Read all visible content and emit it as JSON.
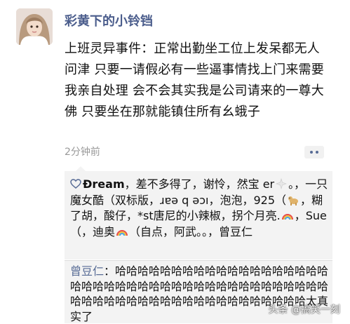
{
  "post": {
    "username": "彩黄下的小铃铛",
    "text": "上班灵异事件：正常出勤坐工位上发呆都无人问津 只要一请假必有一些逼事情找上门来需要我亲自处理 会不会其实我是公司请来的一尊大佛 只要坐在那就能镇住所有幺蛾子",
    "time": "2分钟前"
  },
  "likes": {
    "segments": [
      "Ðream",
      "，差不多得了，谢怜，然宝 er",
      "。，一只魔女酷（双标版，ɹɐǝ q ǝɔı，泡泡，925（",
      "，糊了胡，酸仔，*st唐尼的小辣椒，拐个月亮.",
      "，Sue（，迪奥",
      "（自点，阿武。。，曾豆仁"
    ]
  },
  "comment": {
    "author": "曾豆仁",
    "separator": "：",
    "text": "哈哈哈哈哈哈哈哈哈哈哈哈哈哈哈哈哈哈哈哈哈哈哈哈哈哈哈哈哈哈哈哈哈哈哈哈哈哈哈哈哈哈哈哈哈哈哈哈哈哈哈哈哈哈哈哈哈哈哈哈哈哈哈太真实了"
  },
  "watermark": "头条 @搞笑一刻",
  "colors": {
    "name_blue": "#4b5d8c",
    "link_blue": "#576b95",
    "panel_bg": "#f3f3f3",
    "time_gray": "#999999"
  }
}
